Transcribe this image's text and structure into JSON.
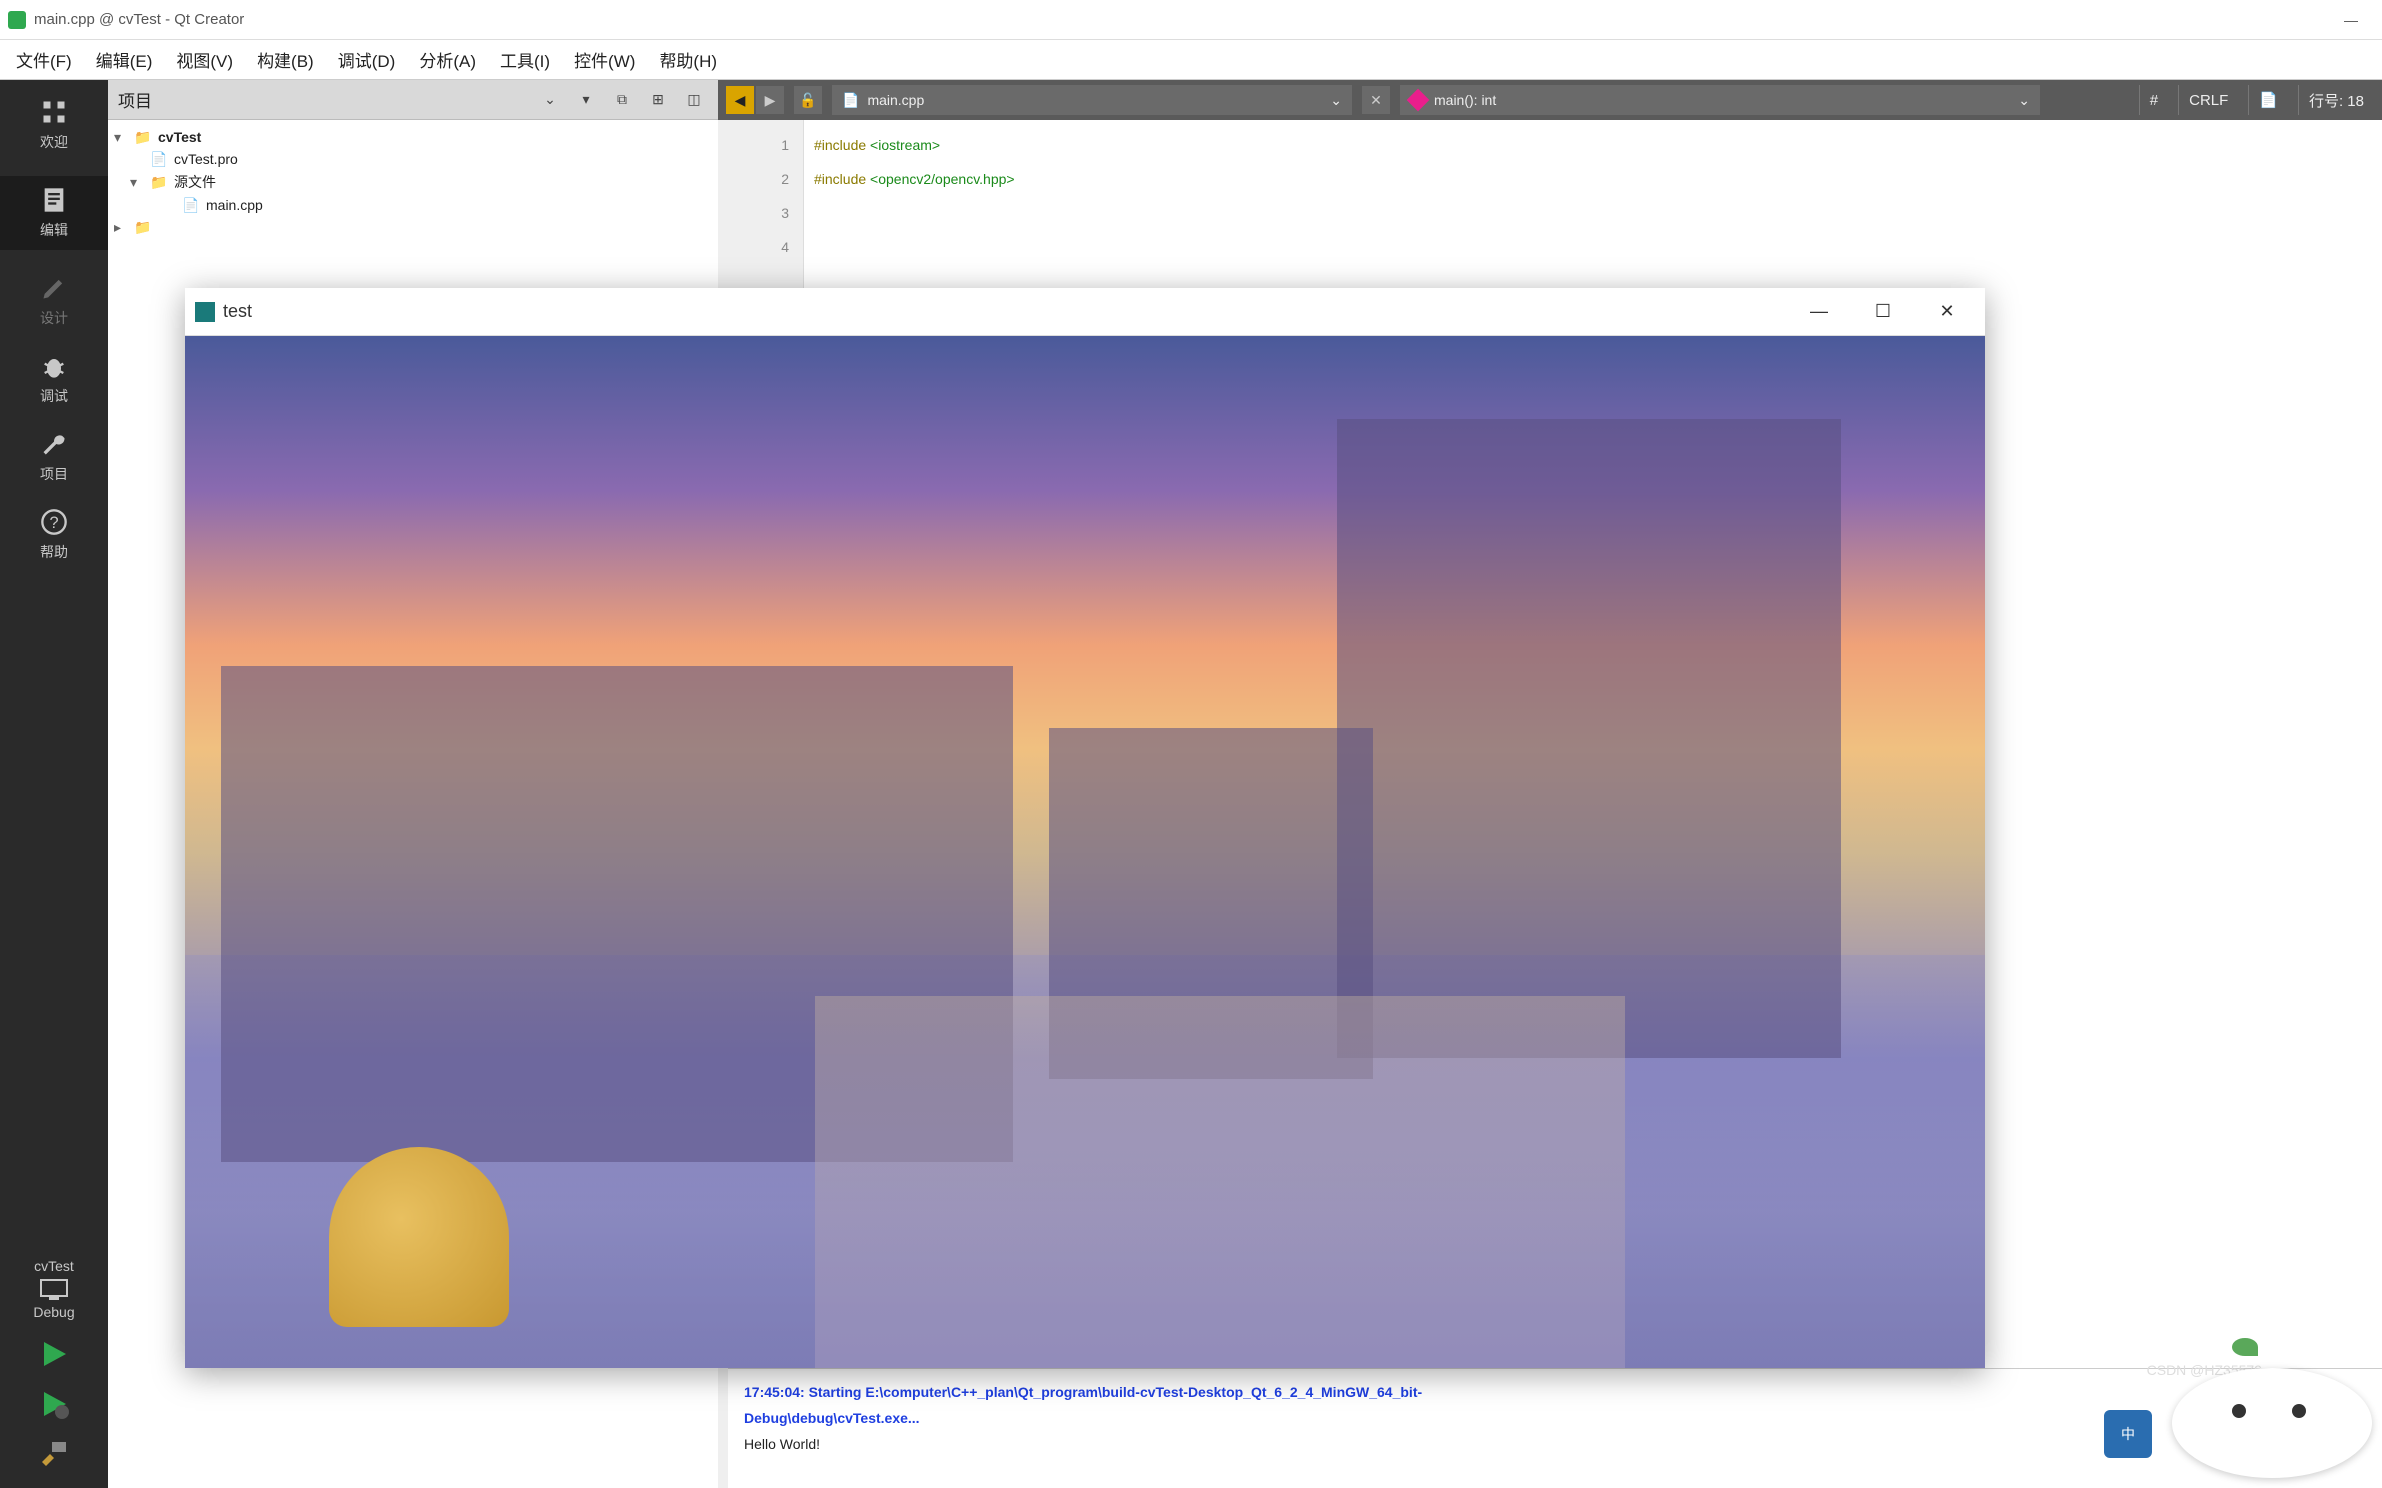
{
  "window": {
    "title": "main.cpp @ cvTest - Qt Creator"
  },
  "menu": {
    "file": "文件(F)",
    "edit": "编辑(E)",
    "view": "视图(V)",
    "build": "构建(B)",
    "debug": "调试(D)",
    "analyze": "分析(A)",
    "tools": "工具(I)",
    "widgets": "控件(W)",
    "help": "帮助(H)"
  },
  "activity": {
    "welcome": "欢迎",
    "editor": "编辑",
    "design": "设计",
    "debug": "调试",
    "project": "项目",
    "help": "帮助"
  },
  "project_panel": {
    "title": "项目",
    "tree": {
      "root": "cvTest",
      "pro": "cvTest.pro",
      "sources_group": "源文件",
      "main": "main.cpp"
    }
  },
  "editor_header": {
    "file": "main.cpp",
    "symbol": "main(): int",
    "hash": "#",
    "crlf": "CRLF",
    "encoding_icon": "📄",
    "line_label": "行号: 18"
  },
  "code": {
    "lines": [
      "1",
      "2",
      "3",
      "4"
    ],
    "l1_kw": "#include ",
    "l1_inc": "<iostream>",
    "l2_kw": "#include ",
    "l2_inc": "<opencv2/opencv.hpp>"
  },
  "target": {
    "project": "cvTest",
    "config": "Debug"
  },
  "output": {
    "line1": "17:45:04: Starting E:\\computer\\C++_plan\\Qt_program\\build-cvTest-Desktop_Qt_6_2_4_MinGW_64_bit-",
    "line2": "Debug\\debug\\cvTest.exe...",
    "line3": "Hello World!"
  },
  "image_window": {
    "title": "test"
  },
  "ime": {
    "label": "中"
  },
  "watermark": "CSDN @HZ35579"
}
